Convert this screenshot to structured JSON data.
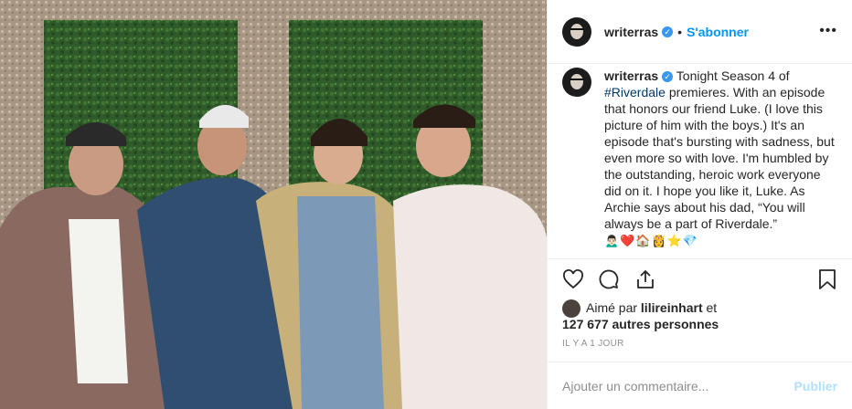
{
  "header": {
    "username": "writerras",
    "verified_icon": "verified-badge-icon",
    "separator": "•",
    "follow_label": "S'abonner",
    "more_label": "•••"
  },
  "caption": {
    "username": "writerras",
    "text_before_hashtag": " Tonight Season 4 of ",
    "hashtag": "#Riverdale",
    "text_after_hashtag": " premieres. With an episode that honors our friend Luke. (I love this picture of him with the boys.) It's an episode that's bursting with sadness, but even more so with love. I'm humbled by the outstanding, heroic work everyone did on it. I hope you like it, Luke. As Archie says about his dad, “You will always be a part of Riverdale.”",
    "emojis": "🙍🏻‍♂️❤️🏠👸⭐💎"
  },
  "actions": {
    "like_icon": "heart-icon",
    "comment_icon": "comment-icon",
    "share_icon": "share-icon",
    "save_icon": "bookmark-icon"
  },
  "likes": {
    "prefix": "Aimé par ",
    "liker": "lilireinhart",
    "connector": " et",
    "others": "127 677 autres personnes"
  },
  "timestamp": "IL Y A 1 JOUR",
  "comment": {
    "placeholder": "Ajouter un commentaire...",
    "publish_label": "Publier"
  },
  "colors": {
    "link_blue": "#0095f6",
    "hashtag": "#00376b",
    "muted": "#8e8e8e",
    "publish_disabled": "#b2dffc",
    "verified": "#3897f0"
  }
}
